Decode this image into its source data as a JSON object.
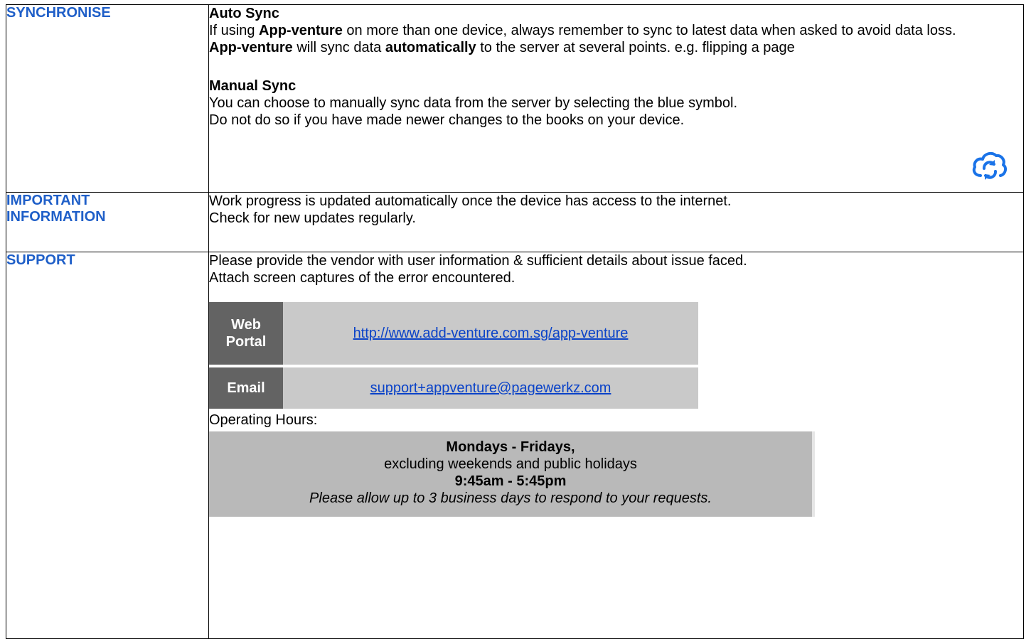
{
  "sections": {
    "sync": {
      "label": "SYNCHRONISE",
      "auto_heading": "Auto Sync",
      "auto_p1_pre": "If using ",
      "auto_p1_brand": "App-venture",
      "auto_p1_post": " on more than one device, always remember to sync to latest data when asked to avoid data loss.",
      "auto_p2_brand": "App-venture",
      "auto_p2_mid": " will sync data ",
      "auto_p2_bold": "automatically",
      "auto_p2_post": " to the server at several points. e.g. flipping a page",
      "manual_heading": "Manual Sync",
      "manual_p1": "You can choose to manually sync data from the server by selecting the blue symbol.",
      "manual_p2": "Do not do so if you have made newer changes to the books on your device.",
      "icon": "cloud-sync-icon",
      "icon_color": "#1a73e8"
    },
    "info": {
      "label_line1": "IMPORTANT",
      "label_line2": "INFORMATION",
      "p1": "Work progress is updated automatically once the device has access to the internet.",
      "p2": "Check for new updates regularly."
    },
    "support": {
      "label": "SUPPORT",
      "p1": "Please provide the vendor with user information & sufficient details about issue faced.",
      "p2": "Attach screen captures of the error encountered.",
      "web_tag": "Web Portal",
      "web_url": "http://www.add-venture.com.sg/app-venture",
      "email_tag": "Email",
      "email": "support+appventure@pagewerkz.com",
      "hours_label": "Operating Hours:",
      "hours_days": "Mondays - Fridays,",
      "hours_excl": "excluding weekends and public holidays",
      "hours_time": "9:45am - 5:45pm",
      "hours_note": "Please allow up to 3 business days to respond to your requests."
    }
  },
  "colors": {
    "label": "#1f5fc8",
    "link": "#0b43c8",
    "tag_bg": "#636363",
    "row_bg": "#c9c9c9",
    "hours_bg": "#b9b9b9"
  }
}
